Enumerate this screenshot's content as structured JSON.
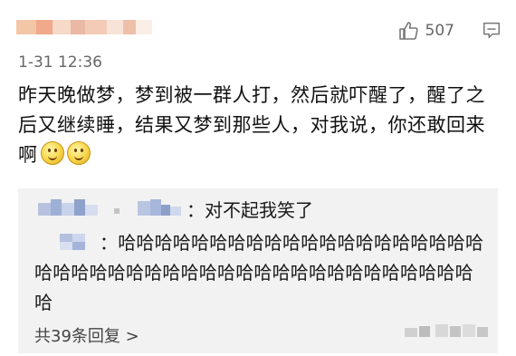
{
  "post": {
    "like_count": "507",
    "timestamp": "1-31 12:36",
    "text": "昨天晚做梦，梦到被一群人打，然后就吓醒了，醒了之后又继续睡，结果又梦到那些人，对我说，你还敢回来啊",
    "emojis": [
      "laughing-emoji",
      "laughing-emoji"
    ]
  },
  "replies": [
    {
      "text": "：对不起我笑了"
    },
    {
      "text": "：哈哈哈哈哈哈哈哈哈哈哈哈哈哈哈哈哈哈哈哈哈哈哈哈哈哈哈哈哈哈哈哈哈哈哈哈哈哈哈哈哈哈哈哈哈"
    }
  ],
  "reply_count_label": "共39条回复 >",
  "icons": {
    "like": "thumbs-up-icon",
    "comment": "comment-icon"
  },
  "colors": {
    "text": "#111111",
    "meta": "#666666",
    "reply_bg": "#f2f2f2"
  }
}
